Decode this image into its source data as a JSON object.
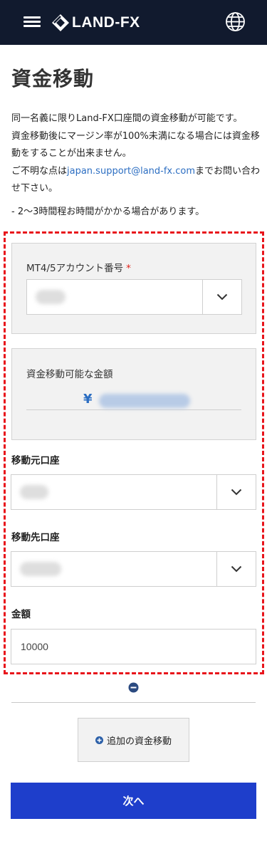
{
  "header": {
    "logo_text": "LAND-FX",
    "menu_icon": "hamburger-menu-icon",
    "language_icon": "globe-icon",
    "background_color": "#111a2e"
  },
  "page": {
    "title": "資金移動",
    "intro_line1": "同一名義に限りLand-FX口座間の資金移動が可能です。",
    "intro_line2": "資金移動後にマージン率が100%未満になる場合には資金移動をすることが出来ません。",
    "intro_line3_before": "ご不明な点は",
    "support_email": "japan.support@land-fx.com",
    "intro_line3_after": "までお問い合わせ下さい。",
    "note": "- 2〜3時間程お時間がかかる場合があります。"
  },
  "form": {
    "account_label": "MT4/5アカウント番号",
    "required_mark": "*",
    "account_value": "",
    "available_label": "資金移動可能な金額",
    "currency_symbol": "¥",
    "available_amount": "",
    "from_label": "移動元口座",
    "from_value": "",
    "to_label": "移動先口座",
    "to_value": "",
    "amount_label": "金額",
    "amount_value": "10000"
  },
  "actions": {
    "remove_icon": "minus-circle-icon",
    "add_icon": "plus-circle-icon",
    "add_label": "追加の資金移動",
    "next_label": "次へ",
    "next_color": "#1e3ecb"
  },
  "colors": {
    "accent": "#2c6ec2",
    "required": "#e2261e",
    "dashed_border": "#e8141b"
  }
}
